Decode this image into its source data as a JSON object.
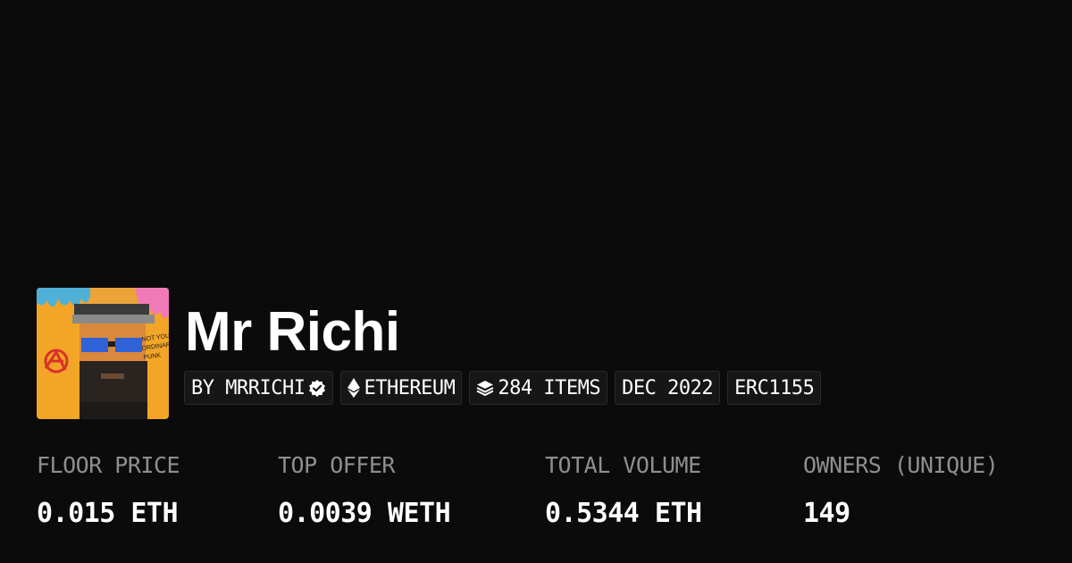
{
  "collection": {
    "name": "Mr Richi",
    "avatar_text": "NOT YOUR ORDINARY PUNK"
  },
  "tags": {
    "creator": "BY MRRICHI",
    "chain": "ETHEREUM",
    "items": "284 ITEMS",
    "date": "DEC 2022",
    "standard": "ERC1155"
  },
  "stats": {
    "floor_price": {
      "label": "FLOOR PRICE",
      "value": "0.015 ETH"
    },
    "top_offer": {
      "label": "TOP OFFER",
      "value": "0.0039 WETH"
    },
    "total_volume": {
      "label": "TOTAL VOLUME",
      "value": "0.5344 ETH"
    },
    "owners": {
      "label": "OWNERS (UNIQUE)",
      "value": "149"
    }
  },
  "colors": {
    "background": "#0b0b0b",
    "tag_background": "#161616",
    "label": "#8f8f8f",
    "value": "#ffffff"
  },
  "icons": {
    "verified": "verified-badge-icon",
    "chain": "ethereum-icon",
    "items": "layers-icon"
  }
}
